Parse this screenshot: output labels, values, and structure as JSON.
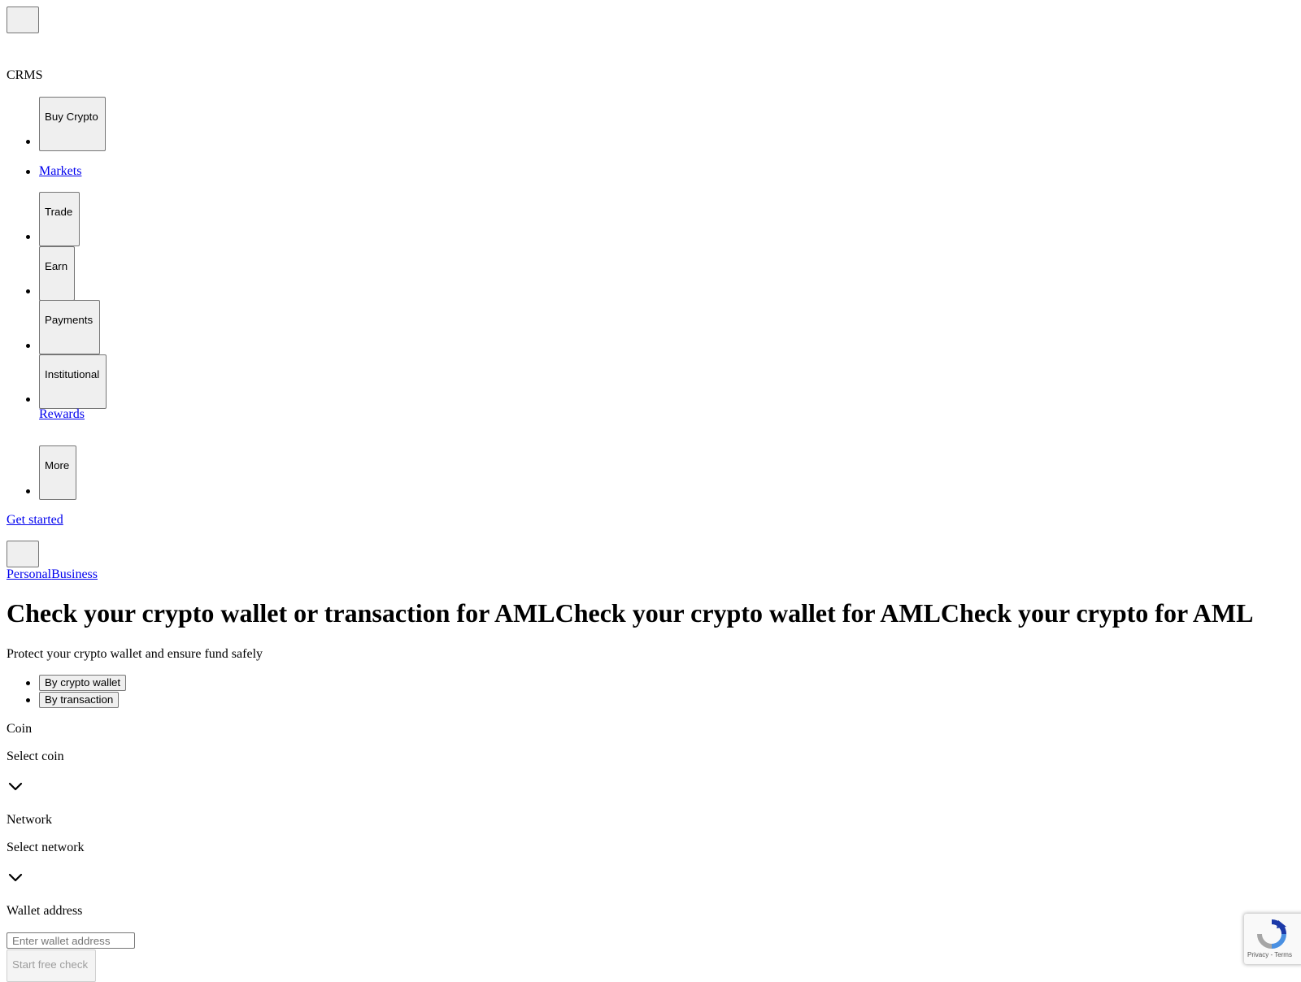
{
  "header": {
    "brand": "CRMS",
    "nav": [
      {
        "label": "Buy Crypto",
        "type": "button"
      },
      {
        "label": "Markets",
        "type": "link"
      },
      {
        "label": "Trade",
        "type": "button"
      },
      {
        "label": "Earn",
        "type": "button"
      },
      {
        "label": "Payments",
        "type": "button"
      },
      {
        "label": "Institutional",
        "type": "button"
      },
      {
        "label": "Rewards",
        "type": "link"
      },
      {
        "label": "More",
        "type": "button"
      }
    ],
    "get_started": "Get started",
    "segment_links": {
      "personal": "Personal",
      "business": "Business"
    }
  },
  "hero": {
    "headline": "Check your crypto wallet or transaction for AMLCheck your crypto wallet for AMLCheck your crypto for AML",
    "subtitle": "Protect your crypto wallet and ensure fund safely",
    "tabs": [
      "By crypto wallet",
      "By transaction"
    ]
  },
  "form": {
    "coin_label": "Coin",
    "coin_value": "Select coin",
    "network_label": "Network",
    "network_value": "Select network",
    "wallet_label": "Wallet address",
    "wallet_placeholder": "Enter wallet address",
    "submit_label": "Start free check"
  },
  "recaptcha": {
    "terms": "Privacy - Terms",
    "icon": "recaptcha-icon"
  }
}
